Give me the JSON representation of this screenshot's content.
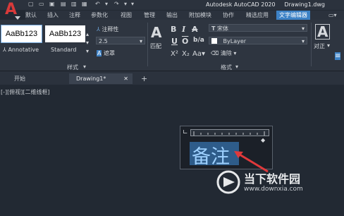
{
  "title_bar": {
    "app_title": "Autodesk AutoCAD 2020",
    "doc_title": "Drawing1.dwg"
  },
  "ribbon_tabs": [
    "默认",
    "插入",
    "注释",
    "参数化",
    "视图",
    "管理",
    "输出",
    "附加模块",
    "协作",
    "精选应用",
    "文字编辑器"
  ],
  "style_panel": {
    "style1_sample": "AaBb123",
    "style1_name": "Annotative",
    "style2_sample": "AaBb123",
    "style2_name": "Standard",
    "label": "样式",
    "annotative_label": "注释性",
    "height_value": "2.5",
    "mask_label": "遮罩"
  },
  "format_panel": {
    "match_label": "匹配",
    "font_value": "宋体",
    "color_value": "ByLayer",
    "clear_label": "清除",
    "label": "格式"
  },
  "paragraph_panel": {
    "align_label": "对正"
  },
  "doc_tabs": {
    "start": "开始",
    "drawing": "Drawing1*",
    "add": "+"
  },
  "viewport_label": "[-][俯视][二维线框]",
  "editor": {
    "text": "备注"
  },
  "watermark": {
    "text": "当下软件园",
    "url": "www.downxia.com"
  },
  "colors": {
    "accent": "#3d82c6",
    "logo_red": "#d83a3a",
    "arrow_red": "#e0393b"
  }
}
